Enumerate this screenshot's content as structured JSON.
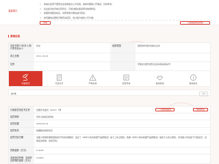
{
  "notice": {
    "label": "温馨提示",
    "lines": [
      {
        "num": "1.",
        "text": "本信息来源于国家企业信用信息公示系统、信用中国等公开渠道，仅供参考。"
      },
      {
        "num": "2.",
        "text": "企业如对处罚信息有异议，可通过相关渠道申请信用修复。"
      },
      {
        "num": "3.",
        "text": "如需查询更多信息，请登录官方网站进行核实。"
      },
      {
        "num": "4.",
        "text": "本页面信息更新可能存在延迟，请以官方最新公示为准。"
      }
    ],
    "small_button": "详情",
    "right_button": "下载信用修复材料"
  },
  "section_title": "基础信息",
  "info": {
    "rows": [
      {
        "k1": "法定代表人/负责人/执行事务合伙人",
        "v1": "张某",
        "k2": "经营范围",
        "v2": "服装制作销售和相关业务"
      },
      {
        "k1": "成立日期",
        "v1": "2011-09-20",
        "k2": "",
        "v2": ""
      },
      {
        "k1": "住所",
        "v1": "",
        "k2": "",
        "v2": "安徽省合肥市肥东县店埠镇某路某号"
      }
    ]
  },
  "tabs": [
    {
      "label": "行政处罚",
      "badge": "1"
    },
    {
      "label": "行政许可",
      "badge": ""
    },
    {
      "label": "严重失信",
      "badge": ""
    },
    {
      "label": "经营异常",
      "badge": ""
    },
    {
      "label": "信用承诺",
      "badge": ""
    },
    {
      "label": "其他信息",
      "badge": ""
    }
  ],
  "sub": {
    "count": "共1条",
    "pager": "1/1"
  },
  "detail": {
    "rows": [
      {
        "k": "行政处罚决定书文号",
        "v": "合肥东市监罚〔2021〕3号"
      },
      {
        "k": "处罚类别",
        "v": "罚款;没收违法所得"
      },
      {
        "k": "处罚依据",
        "v": "2020-05-12"
      },
      {
        "k": "处罚机关",
        "v": "依据相关规定处罚"
      },
      {
        "k": "处罚决定日期",
        "v": "当事人所销售服装经检验不符合标准规定，违反了《中华人民共和国产品质量法》第十三条之规定。依据《中华人民共和国产品质量法》第四十九条之规定，对当事人作出如下行政处罚：没收违法所得，并处罚款。"
      },
      {
        "k": "罚款金额（万元）",
        "v": "0.4100"
      },
      {
        "k": "没收违法所得、没收非法财物的金额（万元）",
        "v": "0.0000"
      }
    ],
    "btn_report": "下载信用报告",
    "btn_repair": "信用修复"
  }
}
